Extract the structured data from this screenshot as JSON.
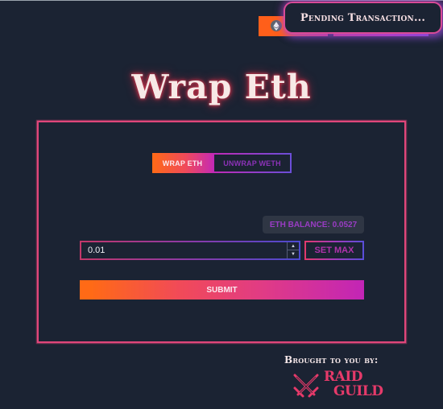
{
  "header": {
    "network_icon": "ethereum-icon",
    "toast": {
      "text": "Pending Transaction..."
    }
  },
  "page": {
    "title": "Wrap Eth"
  },
  "toggle": {
    "options": [
      {
        "label": "WRAP ETH",
        "active": true
      },
      {
        "label": "UNWRAP WETH",
        "active": false
      }
    ]
  },
  "form": {
    "balance_label": "ETH BALANCE: 0.0527",
    "amount_value": "0.01",
    "set_max_label": "SET MAX",
    "submit_label": "SUBMIT"
  },
  "footer": {
    "brought_label": "Brought to you by:",
    "logo_line1": "RAID",
    "logo_line2": "GUILD",
    "logo_icon": "crossed-swords-icon"
  },
  "colors": {
    "background": "#1b2333",
    "accent_pink": "#e0467a",
    "accent_orange": "#ff6a16",
    "accent_purple": "#c225b6"
  }
}
